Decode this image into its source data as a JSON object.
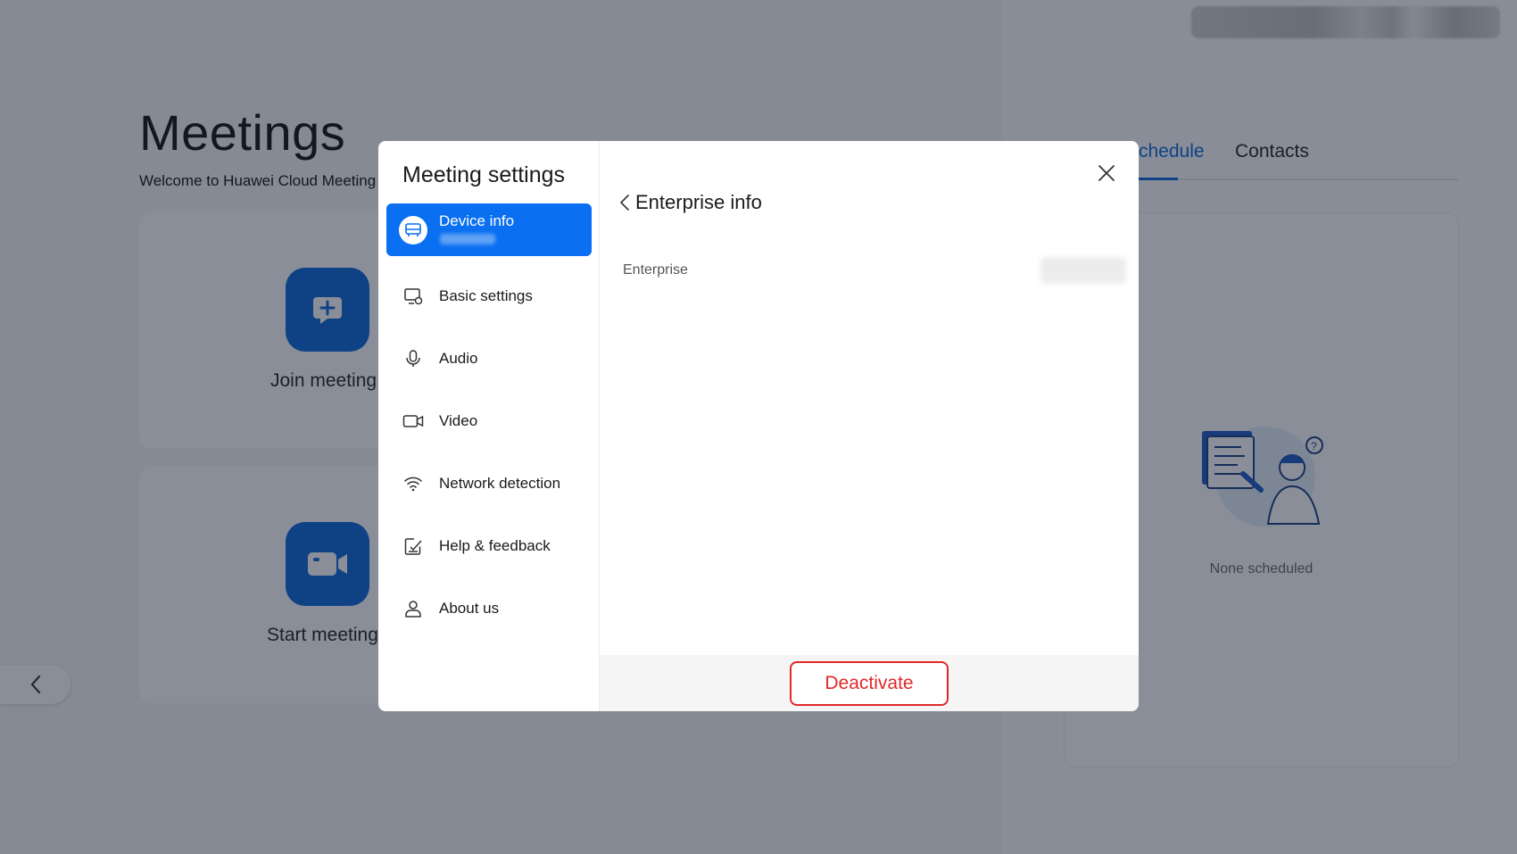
{
  "app": {
    "title": "Meetings",
    "subtitle": "Welcome to Huawei Cloud Meeting",
    "join_label": "Join meeting",
    "start_label": "Start meeting",
    "tabs": [
      {
        "label": "Schedule",
        "active": true
      },
      {
        "label": "Contacts",
        "active": false
      }
    ],
    "empty_text": "None scheduled"
  },
  "modal": {
    "title": "Meeting settings",
    "menu": [
      {
        "label": "Device info",
        "icon": "device-icon",
        "active": true
      },
      {
        "label": "Basic settings",
        "icon": "monitor-settings-icon"
      },
      {
        "label": "Audio",
        "icon": "microphone-icon"
      },
      {
        "label": "Video",
        "icon": "camera-icon"
      },
      {
        "label": "Network detection",
        "icon": "wifi-icon"
      },
      {
        "label": "Help & feedback",
        "icon": "feedback-icon"
      },
      {
        "label": "About us",
        "icon": "user-icon"
      }
    ],
    "section_title": "Enterprise info",
    "rows": [
      {
        "key": "Enterprise",
        "value": ""
      }
    ],
    "deactivate_label": "Deactivate"
  },
  "colors": {
    "accent": "#0a6ff0",
    "danger": "#e0282a"
  }
}
